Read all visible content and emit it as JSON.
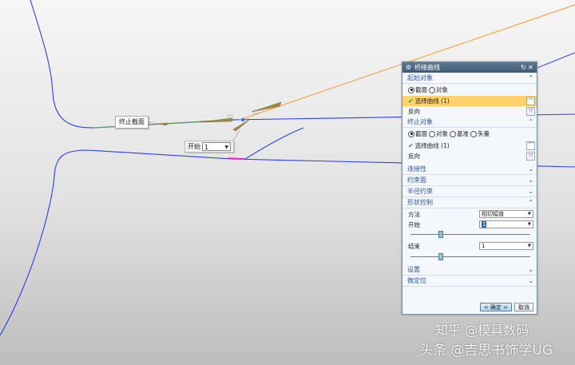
{
  "canvas": {
    "section_label": "终止截面",
    "start_field": {
      "name": "开始",
      "value": "1"
    }
  },
  "dialog": {
    "title": "桥接曲线",
    "title_icon": "gear-icon",
    "start_object": {
      "header": "起始对象",
      "radio_options": [
        "截面",
        "对象"
      ],
      "selected_radio": "截面",
      "select_curve": "选择曲线 (1)",
      "reverse": "反向"
    },
    "end_object": {
      "header": "终止对象",
      "radio_options": [
        "截面",
        "对象",
        "基准",
        "矢量"
      ],
      "selected_radio": "截面",
      "select_curve": "选择曲线 (1)",
      "reverse": "反向"
    },
    "collapsed_sections": [
      "连接性",
      "约束面",
      "半径约束"
    ],
    "shape_control": {
      "header": "形状控制",
      "method_label": "方法",
      "method_value": "相切幅值",
      "start_label": "开始",
      "start_value": "1",
      "end_label": "结束",
      "end_value": "1",
      "start_slider_fraction": 0.25,
      "end_slider_fraction": 0.25
    },
    "bottom_sections": [
      "设置",
      "微定位"
    ],
    "ok_label": "< 确定 >",
    "cancel_label": "取消"
  },
  "watermarks": {
    "zhihu": "知乎 @模具数码",
    "toutiao": "头条 @吉思书饰学UG"
  },
  "colors": {
    "curve_blue": "#2b3fe0",
    "bridge_orange": "#f0a040",
    "highlight_green": "#4caf50",
    "highlight_magenta": "#e020d0",
    "dialog_title": "#4a667e",
    "selected_row": "#ffd36b"
  }
}
